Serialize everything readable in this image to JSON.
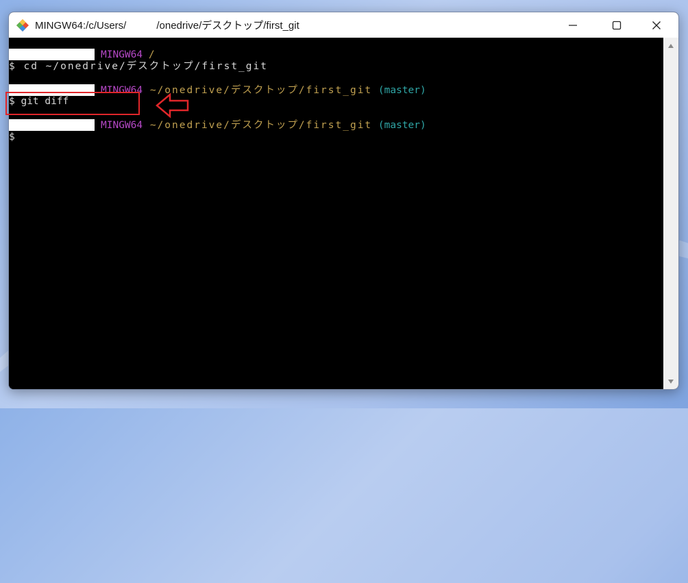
{
  "window": {
    "title_prefix": "MINGW64:/c/Users/",
    "title_suffix": "/onedrive/デスクトップ/first_git"
  },
  "icons": {
    "app": "git-icon",
    "minimize": "minimize-icon",
    "maximize": "maximize-icon",
    "close": "close-icon",
    "scroll_up": "chevron-up-icon",
    "scroll_down": "chevron-down-icon",
    "annotation": "arrow-left-icon"
  },
  "terminal": {
    "prompts": [
      {
        "env": "MINGW64",
        "path": " /",
        "branch": ""
      },
      {
        "env": "MINGW64",
        "path": " ~/onedrive/デスクトップ/first_git",
        "branch": " (master)"
      },
      {
        "env": "MINGW64",
        "path": " ~/onedrive/デスクトップ/first_git",
        "branch": " (master)"
      }
    ],
    "commands": [
      "$ cd ~/onedrive/デスクトップ/first_git",
      "$ git diff",
      "$"
    ]
  },
  "colors": {
    "env": "#b548c6",
    "path": "#c0a050",
    "branch": "#2fa6a6",
    "annotation": "#e0262a"
  }
}
